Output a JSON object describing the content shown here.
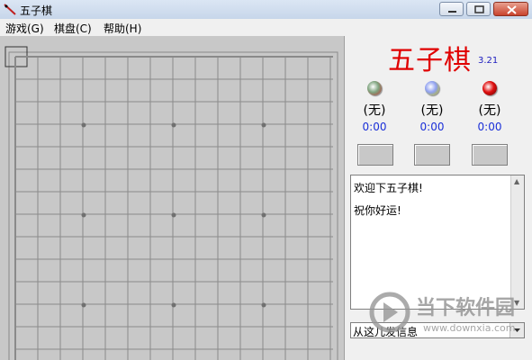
{
  "window": {
    "title": "五子棋"
  },
  "menu": {
    "items": [
      {
        "label": "游戏(G)"
      },
      {
        "label": "棋盘(C)"
      },
      {
        "label": "帮助(H)"
      }
    ]
  },
  "board": {
    "background": "#c8c8c8",
    "line_color": "#8a8a8a",
    "star_points": [
      [
        4,
        4
      ],
      [
        4,
        10
      ],
      [
        4,
        16
      ],
      [
        10,
        4
      ],
      [
        10,
        10
      ],
      [
        10,
        16
      ],
      [
        16,
        4
      ]
    ]
  },
  "panel": {
    "game_title": "五子棋",
    "version": "3.21",
    "players": [
      {
        "name": "(无)",
        "time": "0:00",
        "stone_color": "#7fa47f",
        "accent": "#c03030"
      },
      {
        "name": "(无)",
        "time": "0:00",
        "stone_color": "#8fa0f0",
        "accent": "#c0c000"
      },
      {
        "name": "(无)",
        "time": "0:00",
        "stone_color": "#e01010",
        "accent": "#600000"
      }
    ],
    "chat_lines": [
      "欢迎下五子棋!",
      "祝你好运!"
    ],
    "message_select": "从这儿发信息"
  },
  "watermark": {
    "name": "当下软件园",
    "url": "www.downxia.com"
  }
}
